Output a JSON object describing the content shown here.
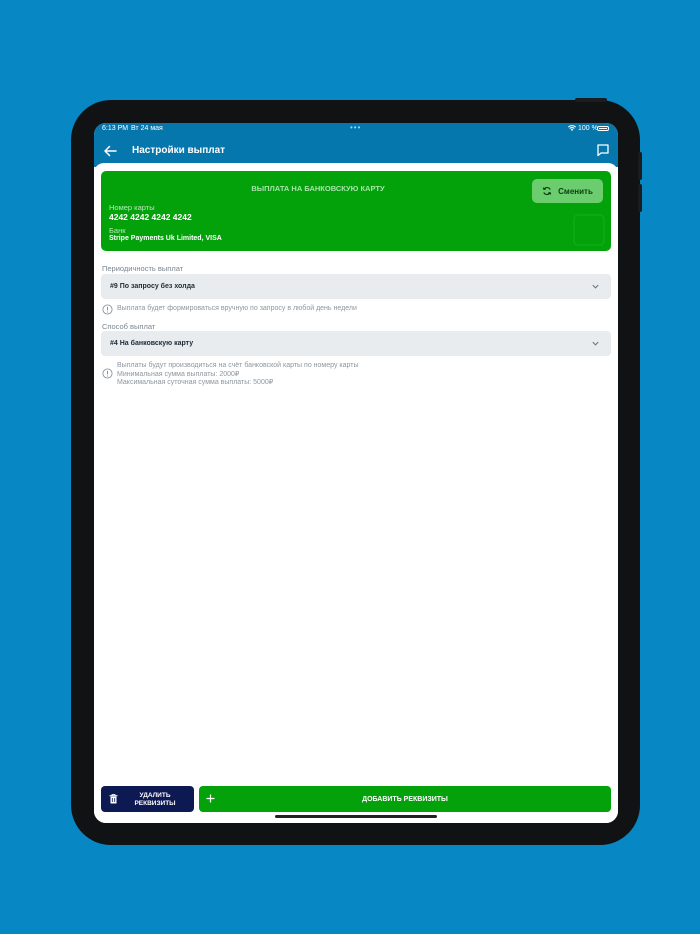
{
  "status_bar": {
    "time": "6:13 PM",
    "date": "Вт 24 мая",
    "battery": "100 %"
  },
  "nav": {
    "title": "Настройки выплат"
  },
  "card": {
    "title": "ВЫПЛАТА НА БАНКОВСКУЮ КАРТУ",
    "change_label": "Сменить",
    "number_label": "Номер карты",
    "number": "4242 4242 4242 4242",
    "bank_label": "Банк",
    "bank": "Stripe Payments Uk Limited, VISA"
  },
  "frequency": {
    "label": "Периодичность выплат",
    "selected": "#9 По запросу без холда",
    "info": "Выплата будет формироваться вручную по запросу в любой день недели"
  },
  "method": {
    "label": "Способ выплат",
    "selected": "#4 На банковскую карту",
    "info_line1": "Выплаты будут производиться на счёт банковской карты по номеру карты",
    "info_line2": "Минимальная сумма выплаты: 2000₽",
    "info_line3": "Максимальная суточная сумма выплаты: 5000₽"
  },
  "actions": {
    "delete_line1": "УДАЛИТЬ",
    "delete_line2": "РЕКВИЗИТЫ",
    "add": "ДОБАВИТЬ РЕКВИЗИТЫ"
  },
  "colors": {
    "background": "#0787c3",
    "header": "#0677ad",
    "accent_green": "#03a20b",
    "delete_navy": "#0d1953"
  }
}
